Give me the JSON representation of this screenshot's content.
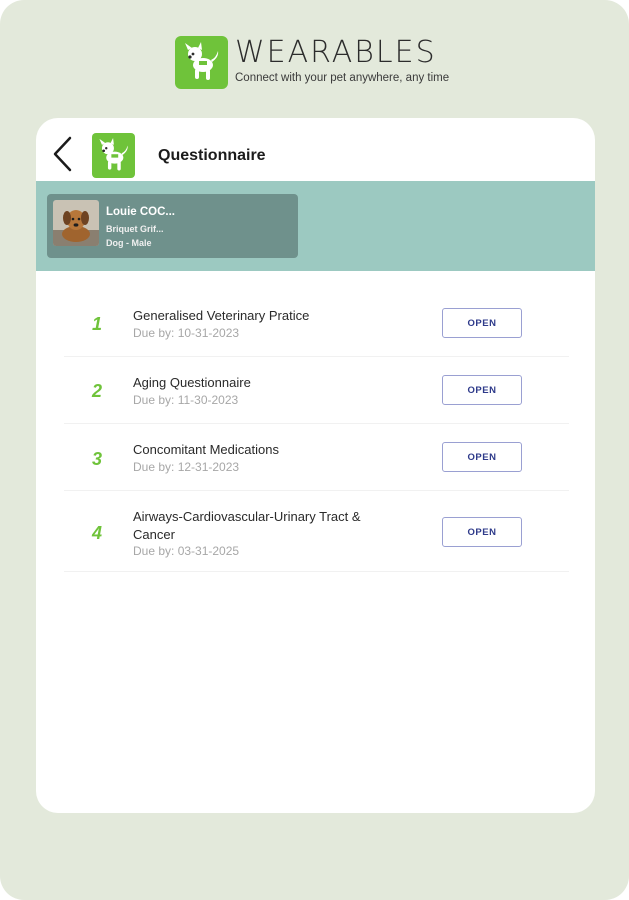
{
  "brand": {
    "name": "WEARABLES",
    "tagline": "Connect with your pet anywhere, any time",
    "accent": "#6fc33a"
  },
  "header": {
    "title": "Questionnaire",
    "back_icon": "chevron-left-icon"
  },
  "pet": {
    "name": "Louie COC...",
    "breed": "Briquet Grif...",
    "info": "Dog - Male"
  },
  "questionnaires": [
    {
      "number": "1",
      "title": "Generalised Veterinary Pratice",
      "due": "Due by: 10-31-2023",
      "action": "OPEN"
    },
    {
      "number": "2",
      "title": "Aging Questionnaire",
      "due": "Due by: 11-30-2023",
      "action": "OPEN"
    },
    {
      "number": "3",
      "title": "Concomitant Medications",
      "due": "Due by: 12-31-2023",
      "action": "OPEN"
    },
    {
      "number": "4",
      "title": "Airways-Cardiovascular-Urinary Tract & Cancer",
      "due": "Due by: 03-31-2025",
      "action": "OPEN"
    }
  ],
  "colors": {
    "background": "#e3e9db",
    "pet_band": "#9cc9c1",
    "pet_card": "#6f918c",
    "button_text": "#2e3a8a"
  }
}
